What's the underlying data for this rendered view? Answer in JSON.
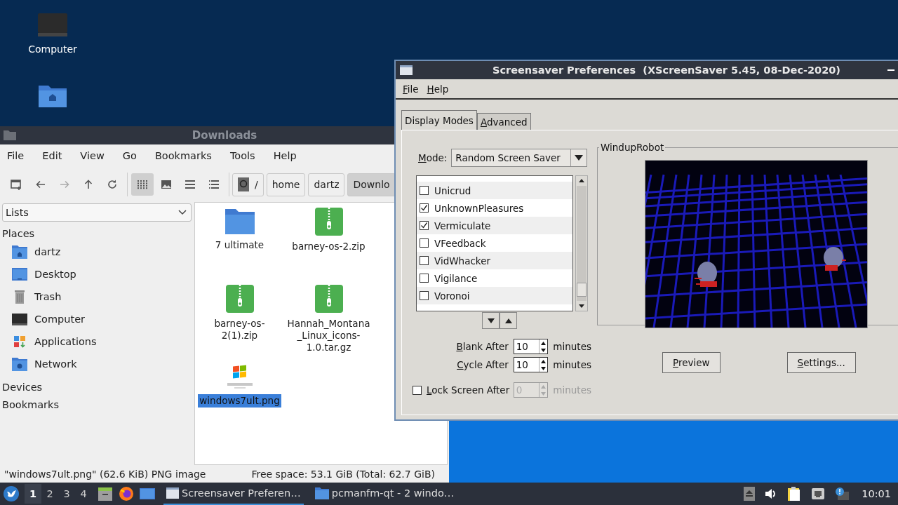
{
  "desktop": {
    "icons": [
      {
        "label": "Computer",
        "kind": "computer"
      },
      {
        "kind": "home-folder"
      }
    ]
  },
  "file_manager": {
    "title": "Downloads",
    "menu": [
      "File",
      "Edit",
      "View",
      "Go",
      "Bookmarks",
      "Tools",
      "Help"
    ],
    "view_modes": [
      {
        "kind": "icons",
        "selected": true
      },
      {
        "kind": "thumbnails",
        "selected": false
      },
      {
        "kind": "compact",
        "selected": false
      },
      {
        "kind": "details",
        "selected": false
      }
    ],
    "path": [
      {
        "label": "/",
        "kind": "root",
        "selected": false
      },
      {
        "label": "home",
        "kind": "dir",
        "selected": false
      },
      {
        "label": "dartz",
        "kind": "dir",
        "selected": false
      },
      {
        "label": "Downlo",
        "kind": "dir",
        "selected": true
      }
    ],
    "sidebar": {
      "dropdown": "Lists",
      "sections": [
        {
          "title": "Places",
          "items": [
            {
              "label": "dartz",
              "kind": "home"
            },
            {
              "label": "Desktop",
              "kind": "desktop"
            },
            {
              "label": "Trash",
              "kind": "trash"
            },
            {
              "label": "Computer",
              "kind": "computer"
            },
            {
              "label": "Applications",
              "kind": "applications"
            },
            {
              "label": "Network",
              "kind": "network"
            }
          ]
        },
        {
          "title": "Devices"
        },
        {
          "title": "Bookmarks"
        }
      ]
    },
    "files": [
      {
        "name": "7 ultimate",
        "kind": "folder",
        "selected": false
      },
      {
        "name": "barney-os-2.zip",
        "kind": "zip",
        "selected": false
      },
      {
        "name": "barney-os-2(1).zip",
        "kind": "zip",
        "selected": false
      },
      {
        "name": "Hannah_Montana_Linux_icons-1.0.tar.gz",
        "kind": "zip",
        "selected": false
      },
      {
        "name": "windows7ult.png",
        "kind": "image",
        "selected": true
      }
    ],
    "status_bar": {
      "selection": "\"windows7ult.png\" (62.6 KiB) PNG image",
      "free_space": "Free space: 53.1 GiB (Total: 62.7 GiB)"
    }
  },
  "screensaver": {
    "title": "Screensaver Preferences  (XScreenSaver 5.45, 08-Dec-2020)",
    "menu": [
      "File",
      "Help"
    ],
    "tabs": [
      {
        "label": "Display Modes",
        "selected": true
      },
      {
        "label": "Advanced",
        "selected": false
      }
    ],
    "mode": {
      "label": "Mode:",
      "value": "Random Screen Saver"
    },
    "savers": [
      {
        "name": "Unicrud",
        "checked": false
      },
      {
        "name": "UnknownPleasures",
        "checked": true
      },
      {
        "name": "Vermiculate",
        "checked": true
      },
      {
        "name": "VFeedback",
        "checked": false
      },
      {
        "name": "VidWhacker",
        "checked": false
      },
      {
        "name": "Vigilance",
        "checked": false
      },
      {
        "name": "Voronoi",
        "checked": false
      }
    ],
    "timers": [
      {
        "kind": "spin",
        "label": "Blank After",
        "value": "10",
        "unit": "minutes"
      },
      {
        "kind": "spin",
        "label": "Cycle After",
        "value": "10",
        "unit": "minutes"
      },
      {
        "kind": "check",
        "label": "Lock Screen After",
        "value": "0",
        "unit": "minutes",
        "checked": false,
        "disabled": true
      }
    ],
    "preview": {
      "title": "WindupRobot"
    },
    "buttons": [
      "Preview",
      "Settings..."
    ]
  },
  "taskbar": {
    "workspaces": [
      {
        "label": "1",
        "selected": true
      },
      {
        "label": "2",
        "selected": false
      },
      {
        "label": "3",
        "selected": false
      },
      {
        "label": "4",
        "selected": false
      }
    ],
    "tasks": [
      {
        "label": "Screensaver Preferen…",
        "kind": "dialog",
        "selected": true
      },
      {
        "label": "pcmanfm-qt - 2 windo…",
        "kind": "folder",
        "selected": false
      }
    ],
    "clock": "10:01"
  }
}
